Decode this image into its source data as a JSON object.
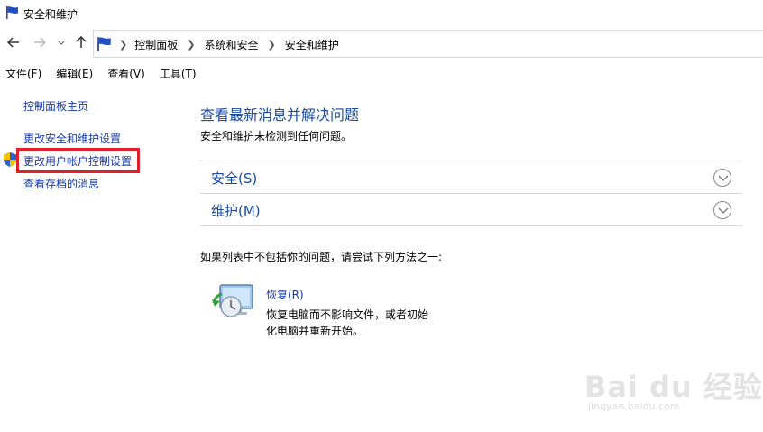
{
  "window": {
    "title": "安全和维护"
  },
  "nav": {
    "back_icon": "arrow-left-icon",
    "forward_icon": "arrow-right-icon",
    "recent_icon": "chevron-down-icon",
    "up_icon": "arrow-up-icon",
    "breadcrumbs": [
      "控制面板",
      "系统和安全",
      "安全和维护"
    ]
  },
  "menu": {
    "items": [
      "文件(F)",
      "编辑(E)",
      "查看(V)",
      "工具(T)"
    ]
  },
  "sidebar": {
    "home": "控制面板主页",
    "links": [
      "更改安全和维护设置",
      "更改用户帐户控制设置",
      "查看存档的消息"
    ]
  },
  "main": {
    "title": "查看最新消息并解决问题",
    "subtitle": "安全和维护未检测到任何问题。",
    "sections": [
      {
        "label": "安全(S)"
      },
      {
        "label": "维护(M)"
      }
    ],
    "hint": "如果列表中不包括你的问题，请尝试下列方法之一:",
    "recovery": {
      "link": "恢复(R)",
      "desc_line1": "恢复电脑而不影响文件，或者初始",
      "desc_line2": "化电脑并重新开始。"
    }
  },
  "watermark": {
    "main": "Bai du 经验",
    "sub": "jingyan.baidu.com"
  },
  "colors": {
    "link": "#1a3aa8",
    "heading": "#1a4aa0",
    "highlight": "#e0202a"
  }
}
